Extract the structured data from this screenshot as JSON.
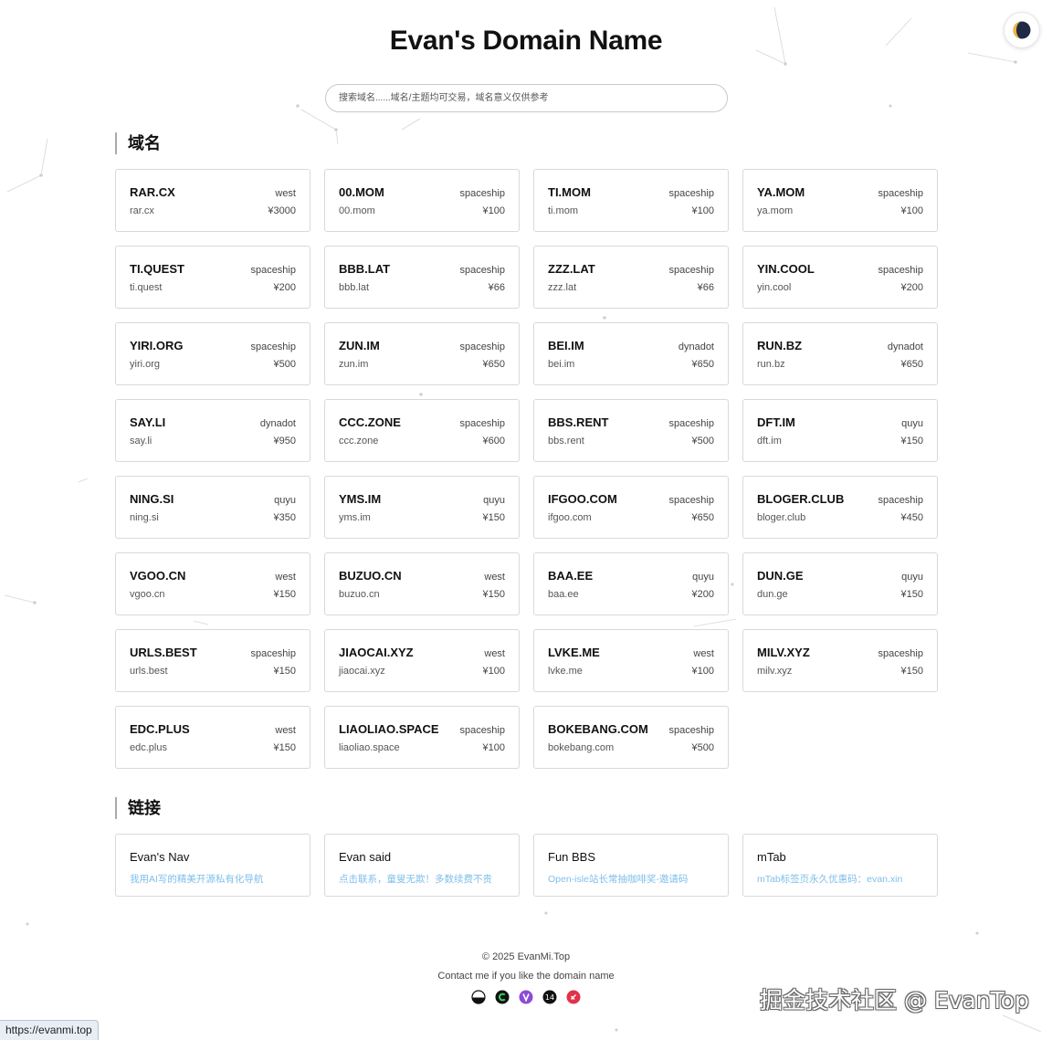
{
  "header": {
    "title": "Evan's Domain Name",
    "search_placeholder": "搜索域名......域名/主题均可交易，域名意义仅供参考",
    "theme_toggle_icon": "half-moon-icon"
  },
  "domains_section": {
    "title": "域名",
    "items": [
      {
        "name": "RAR.CX",
        "registrar": "west",
        "domain": "rar.cx",
        "price": "¥3000"
      },
      {
        "name": "00.MOM",
        "registrar": "spaceship",
        "domain": "00.mom",
        "price": "¥100"
      },
      {
        "name": "TI.MOM",
        "registrar": "spaceship",
        "domain": "ti.mom",
        "price": "¥100"
      },
      {
        "name": "YA.MOM",
        "registrar": "spaceship",
        "domain": "ya.mom",
        "price": "¥100"
      },
      {
        "name": "TI.QUEST",
        "registrar": "spaceship",
        "domain": "ti.quest",
        "price": "¥200"
      },
      {
        "name": "BBB.LAT",
        "registrar": "spaceship",
        "domain": "bbb.lat",
        "price": "¥66"
      },
      {
        "name": "ZZZ.LAT",
        "registrar": "spaceship",
        "domain": "zzz.lat",
        "price": "¥66"
      },
      {
        "name": "YIN.COOL",
        "registrar": "spaceship",
        "domain": "yin.cool",
        "price": "¥200"
      },
      {
        "name": "YIRI.ORG",
        "registrar": "spaceship",
        "domain": "yiri.org",
        "price": "¥500"
      },
      {
        "name": "ZUN.IM",
        "registrar": "spaceship",
        "domain": "zun.im",
        "price": "¥650"
      },
      {
        "name": "BEI.IM",
        "registrar": "dynadot",
        "domain": "bei.im",
        "price": "¥650"
      },
      {
        "name": "RUN.BZ",
        "registrar": "dynadot",
        "domain": "run.bz",
        "price": "¥650"
      },
      {
        "name": "SAY.LI",
        "registrar": "dynadot",
        "domain": "say.li",
        "price": "¥950"
      },
      {
        "name": "CCC.ZONE",
        "registrar": "spaceship",
        "domain": "ccc.zone",
        "price": "¥600"
      },
      {
        "name": "BBS.RENT",
        "registrar": "spaceship",
        "domain": "bbs.rent",
        "price": "¥500"
      },
      {
        "name": "DFT.IM",
        "registrar": "quyu",
        "domain": "dft.im",
        "price": "¥150"
      },
      {
        "name": "NING.SI",
        "registrar": "quyu",
        "domain": "ning.si",
        "price": "¥350"
      },
      {
        "name": "YMS.IM",
        "registrar": "quyu",
        "domain": "yms.im",
        "price": "¥150"
      },
      {
        "name": "IFGOO.COM",
        "registrar": "spaceship",
        "domain": "ifgoo.com",
        "price": "¥650"
      },
      {
        "name": "BLOGER.CLUB",
        "registrar": "spaceship",
        "domain": "bloger.club",
        "price": "¥450"
      },
      {
        "name": "VGOO.CN",
        "registrar": "west",
        "domain": "vgoo.cn",
        "price": "¥150"
      },
      {
        "name": "BUZUO.CN",
        "registrar": "west",
        "domain": "buzuo.cn",
        "price": "¥150"
      },
      {
        "name": "BAA.EE",
        "registrar": "quyu",
        "domain": "baa.ee",
        "price": "¥200"
      },
      {
        "name": "DUN.GE",
        "registrar": "quyu",
        "domain": "dun.ge",
        "price": "¥150"
      },
      {
        "name": "URLS.BEST",
        "registrar": "spaceship",
        "domain": "urls.best",
        "price": "¥150"
      },
      {
        "name": "JIAOCAI.XYZ",
        "registrar": "west",
        "domain": "jiaocai.xyz",
        "price": "¥100"
      },
      {
        "name": "LVKE.ME",
        "registrar": "west",
        "domain": "lvke.me",
        "price": "¥100"
      },
      {
        "name": "MILV.XYZ",
        "registrar": "spaceship",
        "domain": "milv.xyz",
        "price": "¥150"
      },
      {
        "name": "EDC.PLUS",
        "registrar": "west",
        "domain": "edc.plus",
        "price": "¥150"
      },
      {
        "name": "LIAOLIAO.SPACE",
        "registrar": "spaceship",
        "domain": "liaoliao.space",
        "price": "¥100"
      },
      {
        "name": "BOKEBANG.COM",
        "registrar": "spaceship",
        "domain": "bokebang.com",
        "price": "¥500"
      }
    ]
  },
  "links_section": {
    "title": "链接",
    "items": [
      {
        "name": "Evan's Nav",
        "desc": "我用AI写的精美开源私有化导航"
      },
      {
        "name": "Evan said",
        "desc": "点击联系，童叟无欺！多数续费不贵"
      },
      {
        "name": "Fun BBS",
        "desc": "Open-isle站长常抽咖啡奖-邀请码"
      },
      {
        "name": "mTab",
        "desc": "mTab标签页永久优惠码：evan.xin"
      }
    ]
  },
  "footer": {
    "copyright": "© 2025 EvanMi.Top",
    "contact": "Contact me if you like the domain name",
    "socials": [
      {
        "icon": "juejin-icon",
        "color": "#111111"
      },
      {
        "icon": "wechat-icon",
        "color": "#111111"
      },
      {
        "icon": "linux-do-icon",
        "color": "#8a4bd8"
      },
      {
        "icon": "v2ex-icon",
        "color": "#111111"
      },
      {
        "icon": "weibo-icon",
        "color": "#e0324a"
      }
    ]
  },
  "watermark": "掘金技术社区 @ EvanTop",
  "status_bar": {
    "url": "https://evanmi.top"
  },
  "colors": {
    "link_desc": "#7fbfea",
    "card_border": "#d9d9d9",
    "text": "#111111"
  }
}
